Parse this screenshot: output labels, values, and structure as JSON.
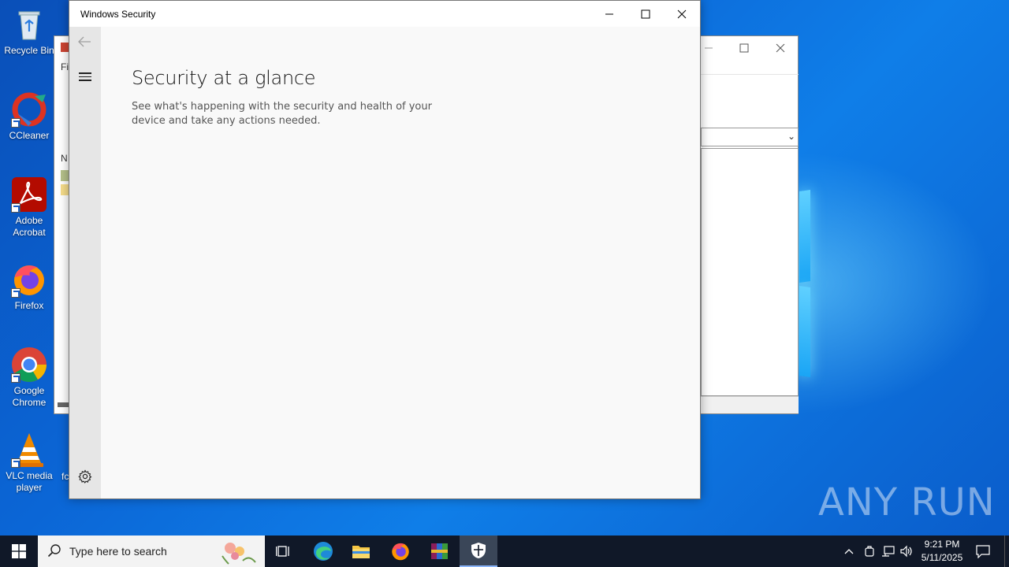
{
  "desktop": {
    "icons": [
      {
        "label": "Recycle Bin"
      },
      {
        "label": "CCleaner"
      },
      {
        "label": "Adobe Acrobat"
      },
      {
        "label": "Firefox"
      },
      {
        "label": "Google Chrome"
      },
      {
        "label": "VLC media player"
      }
    ],
    "partial_label": "fc",
    "watermark": "ANY RUN"
  },
  "background_window": {
    "menu_fragment": "Fil",
    "column_fragment": "N"
  },
  "security_window": {
    "title": "Windows Security",
    "heading": "Security at a glance",
    "description": "See what's happening with the security and health of your device and take any actions needed."
  },
  "taskbar": {
    "search_placeholder": "Type here to search",
    "clock_time": "9:21 PM",
    "clock_date": "5/11/2025"
  },
  "colors": {
    "desktop": "#0b66d6",
    "taskbar": "#101828",
    "nav_rail": "#e6e6e6"
  }
}
